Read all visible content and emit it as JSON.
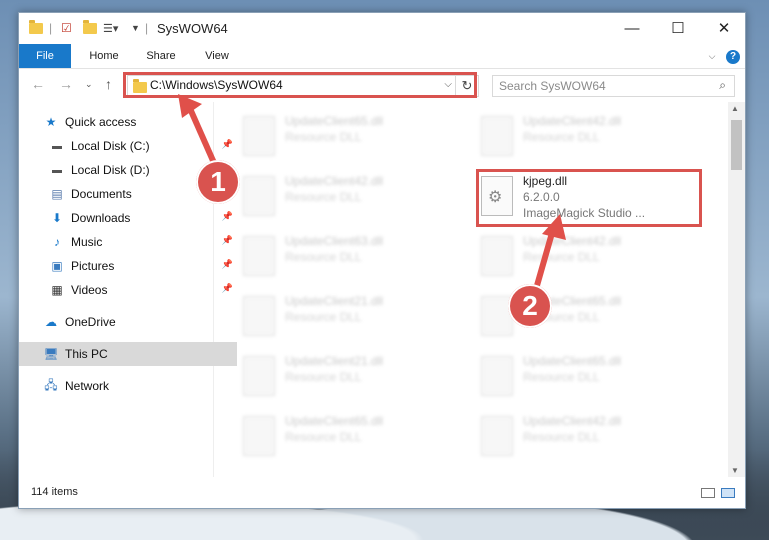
{
  "window": {
    "title": "SysWOW64"
  },
  "ribbon": {
    "tabs": [
      "File",
      "Home",
      "Share",
      "View"
    ]
  },
  "address": {
    "path": "C:\\Windows\\SysWOW64"
  },
  "search": {
    "placeholder": "Search SysWOW64"
  },
  "sidebar": {
    "items": [
      {
        "label": "Quick access"
      },
      {
        "label": "Local Disk (C:)"
      },
      {
        "label": "Local Disk (D:)"
      },
      {
        "label": "Documents"
      },
      {
        "label": "Downloads"
      },
      {
        "label": "Music"
      },
      {
        "label": "Pictures"
      },
      {
        "label": "Videos"
      },
      {
        "label": "OneDrive"
      },
      {
        "label": "This PC"
      },
      {
        "label": "Network"
      }
    ]
  },
  "files": {
    "left": [
      {
        "name": "UpdateClient65.dll",
        "desc": "Resource DLL"
      },
      {
        "name": "UpdateClient42.dll",
        "desc": "Resource DLL"
      },
      {
        "name": "UpdateClient63.dll",
        "desc": "Resource DLL"
      },
      {
        "name": "UpdateClient21.dll",
        "desc": "Resource DLL"
      },
      {
        "name": "UpdateClient21.dll",
        "desc": "Resource DLL"
      },
      {
        "name": "UpdateClient65.dll",
        "desc": "Resource DLL"
      }
    ],
    "right": [
      {
        "name": "UpdateClient42.dll",
        "desc": "Resource DLL"
      },
      {
        "name": "UpdateClient42.dll",
        "desc": "Resource DLL"
      },
      {
        "name": "UpdateClient65.dll",
        "desc": "Resource DLL"
      },
      {
        "name": "UpdateClient65.dll",
        "desc": "Resource DLL"
      },
      {
        "name": "UpdateClient42.dll",
        "desc": "Resource DLL"
      }
    ],
    "highlighted": {
      "name": "kjpeg.dll",
      "version": "6.2.0.0",
      "company": "ImageMagick Studio ..."
    }
  },
  "status": {
    "count": "114 items"
  },
  "annotations": {
    "step1": "1",
    "step2": "2"
  },
  "colors": {
    "accent": "#1979ca",
    "highlight": "#d9534f"
  }
}
